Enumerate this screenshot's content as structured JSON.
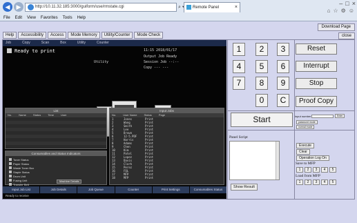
{
  "browser": {
    "url": "http://10.11.32.185:3000/guiform/use/rmstate.cgi",
    "tab_title": "Remote Panel",
    "tab_close": "×",
    "back": "◀",
    "forward": "▶",
    "addr_tools": [
      "⌕ ▾",
      "↻",
      "×"
    ],
    "window_controls": [
      "–",
      "□",
      "×"
    ],
    "right_icons": [
      "⌂",
      "☆",
      "⚙",
      "☺"
    ],
    "menu": [
      "File",
      "Edit",
      "View",
      "Favorites",
      "Tools",
      "Help"
    ]
  },
  "toolbar": {
    "download": "Download Page",
    "buttons": [
      "Help",
      "Accessibility",
      "Access",
      "Mode Memory",
      "Utility/Counter",
      "Mode Check"
    ],
    "close": "close"
  },
  "screen": {
    "top_tabs": [
      "Job",
      "Copy",
      "Scan",
      "Box",
      "Utility",
      "Counter"
    ],
    "ready": "Ready to print",
    "info": [
      "11:15 2018/01/17",
      "Utility",
      "Output Job  Ready",
      "Session Job  --:--",
      "Copy  --- ---"
    ],
    "left_panel_title": "List",
    "left_cols": [
      "No.",
      "Name",
      "Status",
      "Time",
      "User"
    ],
    "right_panel_title": "Input Jobs",
    "right_cols": [
      "No.",
      "User Name",
      "Status",
      "Page"
    ],
    "jobs": [
      [
        "1",
        "Jones",
        "Print"
      ],
      [
        "2",
        "Wang",
        "Print"
      ],
      [
        "3",
        "Smith",
        "Print"
      ],
      [
        "4",
        "Lee",
        "Print"
      ],
      [
        "5",
        "Brown",
        "Print"
      ],
      [
        "6",
        "12-5.PDF",
        "Print"
      ],
      [
        "7",
        "Harris",
        "Print"
      ],
      [
        "8",
        "Adams",
        "Print"
      ],
      [
        "9",
        "Chen",
        "Print"
      ],
      [
        "10",
        "Kim",
        "Print"
      ],
      [
        "11",
        "Patel",
        "Print"
      ],
      [
        "12",
        "Lopez",
        "Print"
      ],
      [
        "13",
        "Davis",
        "Print"
      ],
      [
        "14",
        "Clark",
        "Print"
      ],
      [
        "15",
        "Perez",
        "Print"
      ],
      [
        "16",
        "FQL",
        "Print"
      ],
      [
        "17",
        "MFP",
        "Print"
      ],
      [
        "18",
        "MFP",
        "Print"
      ]
    ],
    "consumables_title": "Consumables and Status Indicators",
    "consumables": [
      "Toner Status",
      "Paper Status",
      "Waste Toner Box",
      "Staple Status",
      "Drum Unit",
      "Fusing Unit",
      "Transfer Belt",
      "Punch Waste"
    ],
    "consumables_button": "Machine Details",
    "bottom_tabs": [
      "Input Job List",
      "Job Details",
      "Job Queue",
      "Counter",
      "Print Settings",
      "Consumables Status"
    ],
    "status": "Ready to receive"
  },
  "keypad": {
    "digits": [
      "1",
      "2",
      "3",
      "4",
      "5",
      "6",
      "7",
      "8",
      "9",
      "0",
      "C"
    ],
    "reset": "Reset",
    "interrupt": "Interrupt",
    "stop": "Stop",
    "proof": "Proof Copy",
    "start": "Start"
  },
  "right": {
    "input_label": "input number",
    "enter": "Enter",
    "mode_a": "password mode",
    "mode_b": "normal mode",
    "panel_script": "Panel Script",
    "show_result": "Show Result",
    "execute": "Execute",
    "clear": "Clear",
    "operation_logon": "Operation Log On",
    "save_label": "Save to MFP",
    "load_label": "Load from MFP",
    "slots": [
      "1",
      "2",
      "3",
      "4",
      "5"
    ]
  }
}
